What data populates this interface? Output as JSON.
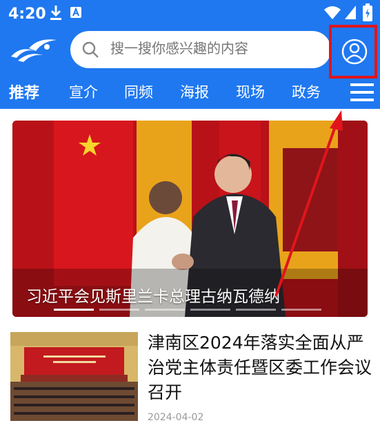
{
  "status_bar": {
    "time": "4:20"
  },
  "header": {
    "search_placeholder": "搜一搜你感兴趣的内容"
  },
  "tabs": [
    {
      "label": "推荐",
      "active": true
    },
    {
      "label": "宣介",
      "active": false
    },
    {
      "label": "同频",
      "active": false
    },
    {
      "label": "海报",
      "active": false
    },
    {
      "label": "现场",
      "active": false
    },
    {
      "label": "政务",
      "active": false
    }
  ],
  "hero": {
    "caption": "习近平会见斯里兰卡总理古纳瓦德纳",
    "slide_count": 6,
    "active_slide": 1
  },
  "news": [
    {
      "title": "津南区2024年落实全面从严治党主体责任暨区委工作会议召开",
      "date": "2024-04-02"
    }
  ],
  "colors": {
    "brand_blue": "#1f78f0",
    "highlight_red": "#e0151b"
  },
  "icons": [
    "download-icon",
    "a-notification-icon",
    "wifi-icon",
    "signal-icon",
    "battery-icon",
    "logo-icon",
    "search-icon",
    "user-icon",
    "menu-icon"
  ]
}
